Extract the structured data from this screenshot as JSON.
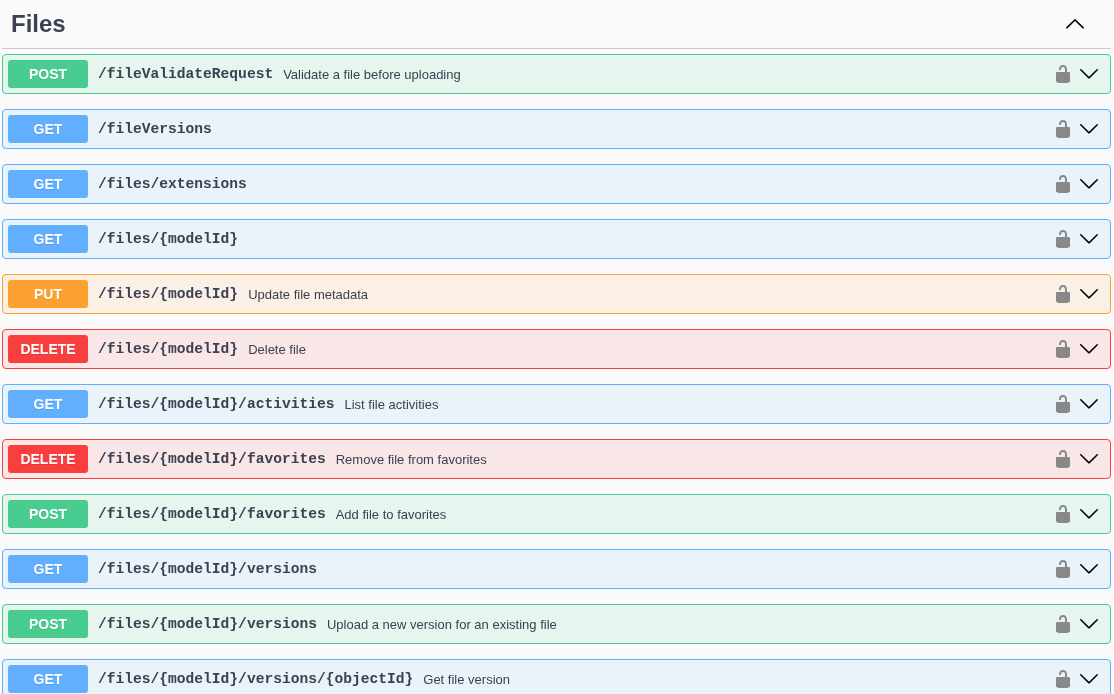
{
  "section": {
    "title": "Files",
    "expanded": true
  },
  "operations": [
    {
      "method": "POST",
      "color": "#49cc90",
      "path": "/fileValidateRequest",
      "summary": "Validate a file before uploading",
      "locked": false,
      "expanded": false
    },
    {
      "method": "GET",
      "color": "#61affe",
      "path": "/fileVersions",
      "locked": false,
      "expanded": false
    },
    {
      "method": "GET",
      "color": "#61affe",
      "path": "/files/extensions",
      "locked": false,
      "expanded": false
    },
    {
      "method": "GET",
      "color": "#61affe",
      "path": "/files/{modelId}",
      "locked": false,
      "expanded": false
    },
    {
      "method": "PUT",
      "color": "#fca130",
      "path": "/files/{modelId}",
      "summary": "Update file metadata",
      "locked": false,
      "expanded": false
    },
    {
      "method": "DELETE",
      "color": "#f93e3e",
      "path": "/files/{modelId}",
      "summary": "Delete file",
      "locked": false,
      "expanded": false
    },
    {
      "method": "GET",
      "color": "#61affe",
      "path": "/files/{modelId}/activities",
      "summary": "List file activities",
      "locked": false,
      "expanded": false
    },
    {
      "method": "DELETE",
      "color": "#f93e3e",
      "path": "/files/{modelId}/favorites",
      "summary": "Remove file from favorites",
      "locked": false,
      "expanded": false
    },
    {
      "method": "POST",
      "color": "#49cc90",
      "path": "/files/{modelId}/favorites",
      "summary": "Add file to favorites",
      "locked": false,
      "expanded": false
    },
    {
      "method": "GET",
      "color": "#61affe",
      "path": "/files/{modelId}/versions",
      "locked": false,
      "expanded": false
    },
    {
      "method": "POST",
      "color": "#49cc90",
      "path": "/files/{modelId}/versions",
      "summary": "Upload a new version for an existing file",
      "locked": false,
      "expanded": false
    },
    {
      "method": "GET",
      "color": "#61affe",
      "path": "/files/{modelId}/versions/{objectId}",
      "summary": "Get file version",
      "locked": false,
      "expanded": false
    }
  ]
}
